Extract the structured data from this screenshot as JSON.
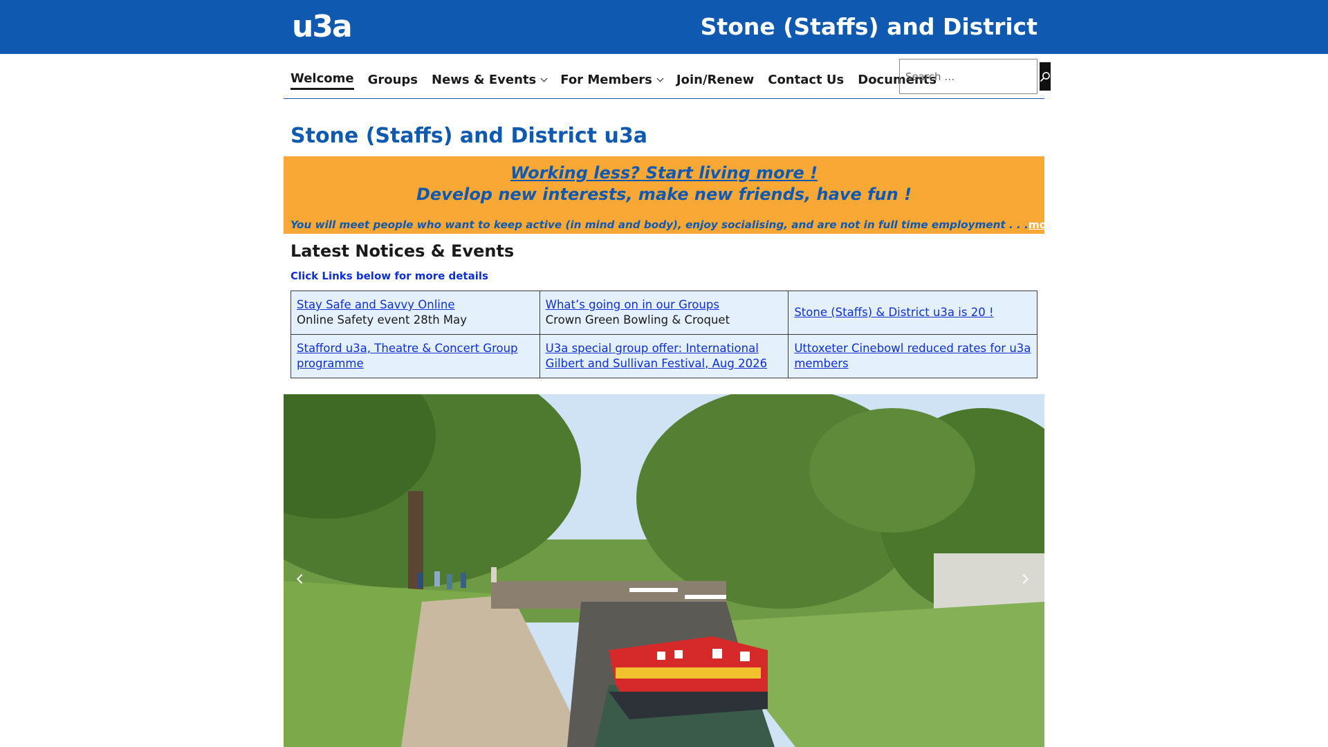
{
  "header": {
    "logo_text": "u3a",
    "site_title": "Stone (Staffs) and District"
  },
  "nav": {
    "items": [
      {
        "label": "Welcome",
        "active": true,
        "has_dropdown": false
      },
      {
        "label": "Groups",
        "active": false,
        "has_dropdown": false
      },
      {
        "label": "News & Events",
        "active": false,
        "has_dropdown": true
      },
      {
        "label": "For Members",
        "active": false,
        "has_dropdown": true
      },
      {
        "label": "Join/Renew",
        "active": false,
        "has_dropdown": false
      },
      {
        "label": "Contact Us",
        "active": false,
        "has_dropdown": false
      },
      {
        "label": "Documents",
        "active": false,
        "has_dropdown": false
      }
    ],
    "search": {
      "placeholder": "Search …",
      "icon": "search-icon"
    }
  },
  "page": {
    "title": "Stone (Staffs) and District u3a"
  },
  "banner": {
    "headline": "Working less? Start living more !",
    "subheadline": "Develop new interests, make new friends, have fun !",
    "body": "You will meet people who want to keep active (in mind and body), enjoy socialising, and are not in full time employment . . .",
    "more_link": "more"
  },
  "notices": {
    "heading": "Latest Notices & Events",
    "subheading": "Click Links below for more details",
    "rows": [
      [
        {
          "link": "Stay Safe and Savvy Online",
          "desc": "Online Safety event 28th May"
        },
        {
          "link": "What’s going on in our Groups",
          "desc": "Crown Green Bowling & Croquet"
        },
        {
          "link": "Stone (Staffs) & District u3a is 20 !",
          "desc": ""
        }
      ],
      [
        {
          "link": "Stafford u3a, Theatre & Concert Group programme",
          "desc": ""
        },
        {
          "link": "U3a special group offer: International Gilbert and Sullivan Festival, Aug 2026",
          "desc": ""
        },
        {
          "link": "Uttoxeter Cinebowl reduced rates for u3a members",
          "desc": ""
        }
      ]
    ]
  },
  "carousel": {
    "prev_icon": "chevron-left-icon",
    "next_icon": "chevron-right-icon"
  },
  "colors": {
    "brand_blue": "#0f5ab0",
    "banner_orange": "#f9a836",
    "link_blue": "#0f2fd6",
    "table_bg": "#e4f0fc"
  }
}
